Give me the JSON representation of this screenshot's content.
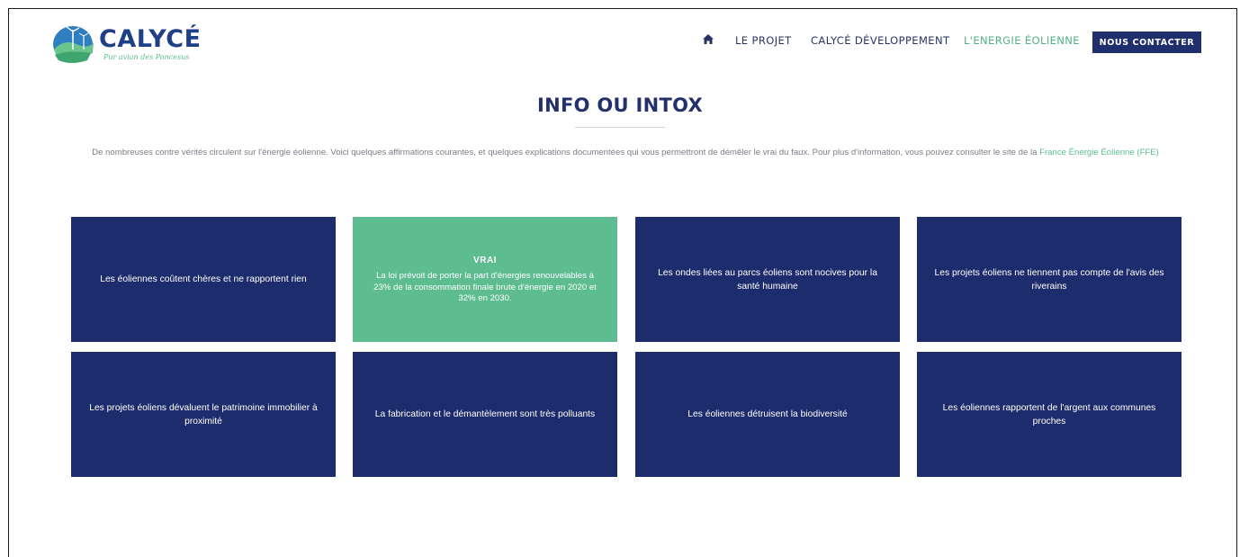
{
  "header": {
    "logo": {
      "name": "CALYCÉ",
      "tagline": "Pur avian des Poncesus"
    },
    "nav": {
      "home_icon": "home-icon",
      "items": [
        {
          "label": "LE PROJET",
          "active": false
        },
        {
          "label": "CALYCÉ DÉVELOPPEMENT",
          "active": false
        },
        {
          "label": "L'ENERGIE ÉOLIENNE",
          "active": true
        }
      ],
      "contact_label": "NOUS CONTACTER"
    }
  },
  "main": {
    "title": "INFO OU INTOX",
    "intro_text": "De nombreuses contre vérités circulent sur l'énergie éolienne. Voici quelques affirmations courantes, et quelques explications documentées qui vous permettront de démêler le vrai du faux. Pour plus d'information, vous pouvez consulter le site de la",
    "intro_link": "France Énergie Éolienne (FFE)",
    "cards": [
      {
        "text": "Les éoliennes coûtent chères et ne rapportent rien"
      },
      {
        "text": "",
        "verdict": "VRAI",
        "explanation": "La loi prévoit de porter la part d'énergies renouvelables à 23% de la consommation finale brute d'énergie en 2020 et 32% en 2030."
      },
      {
        "text": "Les ondes liées au parcs éoliens sont nocives pour la santé humaine"
      },
      {
        "text": "Les projets éoliens ne tiennent pas compte de l'avis des riverains"
      },
      {
        "text": "Les projets éoliens dévaluent le patrimoine immobilier à proximité"
      },
      {
        "text": "La fabrication et le démantèlement sont très polluants"
      },
      {
        "text": "Les éoliennes détruisent la biodiversité"
      },
      {
        "text": "Les éoliennes rapportent de l'argent aux communes proches"
      }
    ]
  },
  "colors": {
    "navy": "#1d2c6c",
    "green": "#5dbd91",
    "title": "#24306b"
  }
}
